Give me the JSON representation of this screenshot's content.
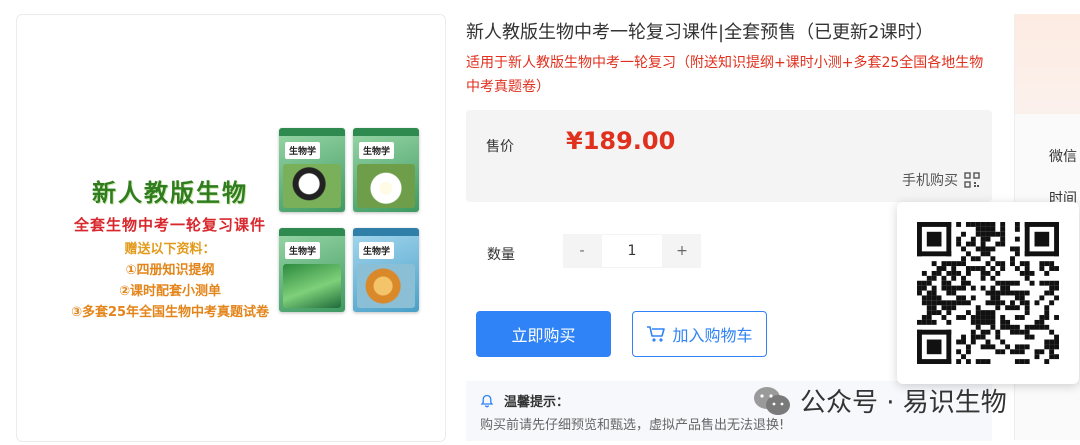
{
  "product": {
    "title": "新人教版生物中考一轮复习课件|全套预售（已更新2课时）",
    "subtitle": "适用于新人教版生物中考一轮复习（附送知识提纲+课时小测+多套25全国各地生物中考真题卷）"
  },
  "cover": {
    "headline": "新人教版生物",
    "subheadline": "全套生物中考一轮复习课件",
    "gift_title": "赠送以下资料：",
    "gift_items": [
      "①四册知识提纲",
      "②课时配套小测单",
      "③多套25年全国生物中考真题试卷"
    ],
    "book_label": "生物学"
  },
  "price": {
    "label": "售价",
    "value": "¥189.00",
    "mobile_buy": "手机购买"
  },
  "quantity": {
    "label": "数量",
    "minus": "-",
    "value": "1",
    "plus": "+"
  },
  "actions": {
    "buy_now": "立即购买",
    "add_to_cart": "加入购物车"
  },
  "tips": {
    "title": "温馨提示：",
    "text": "购买前请先仔细预览和甄选，虚拟产品售出无法退换!"
  },
  "side": {
    "label_1": "微信",
    "label_2": "时间"
  },
  "watermark": {
    "text": "公众号 · 易识生物"
  },
  "colors": {
    "accent": "#2f83f6",
    "price": "#e0301e",
    "subtitle": "#e0301e"
  }
}
